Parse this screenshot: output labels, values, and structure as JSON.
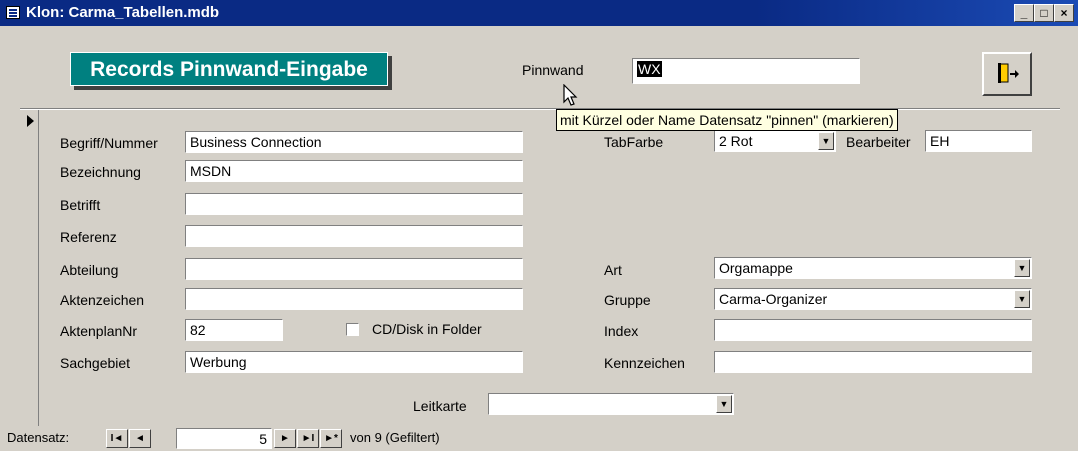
{
  "window": {
    "title": "Klon: Carma_Tabellen.mdb",
    "minimize": "_",
    "restore": "□",
    "close": "×"
  },
  "form": {
    "title": "Records Pinnwand-Eingabe"
  },
  "pinnwand": {
    "label": "Pinnwand",
    "value": "WX"
  },
  "tooltip": {
    "text": "mit Kürzel oder Name Datensatz \"pinnen\" (markieren)"
  },
  "fields": {
    "begriff": {
      "label": "Begriff/Nummer",
      "value": "Business Connection"
    },
    "bezeichnung": {
      "label": "Bezeichnung",
      "value": "MSDN"
    },
    "betrifft": {
      "label": "Betrifft",
      "value": ""
    },
    "referenz": {
      "label": "Referenz",
      "value": ""
    },
    "abteilung": {
      "label": "Abteilung",
      "value": ""
    },
    "aktenzeichen": {
      "label": "Aktenzeichen",
      "value": ""
    },
    "aktenplannr": {
      "label": "AktenplanNr",
      "value": "82"
    },
    "cddisk": {
      "label": "CD/Disk in Folder",
      "checked": false
    },
    "sachgebiet": {
      "label": "Sachgebiet",
      "value": "Werbung"
    },
    "tabfarbe": {
      "label": "TabFarbe",
      "value": "2 Rot"
    },
    "bearbeiter": {
      "label": "Bearbeiter",
      "value": "EH"
    },
    "art": {
      "label": "Art",
      "value": "Orgamappe"
    },
    "gruppe": {
      "label": "Gruppe",
      "value": "Carma-Organizer"
    },
    "index": {
      "label": "Index",
      "value": ""
    },
    "kennzeichen": {
      "label": "Kennzeichen",
      "value": ""
    },
    "leitkarte": {
      "label": "Leitkarte",
      "value": ""
    }
  },
  "navigation": {
    "label": "Datensatz:",
    "current": "5",
    "first": "I◄",
    "prev": "◄",
    "next": "►",
    "last": "►I",
    "new": "►*",
    "total": "von  9 (Gefiltert)"
  }
}
